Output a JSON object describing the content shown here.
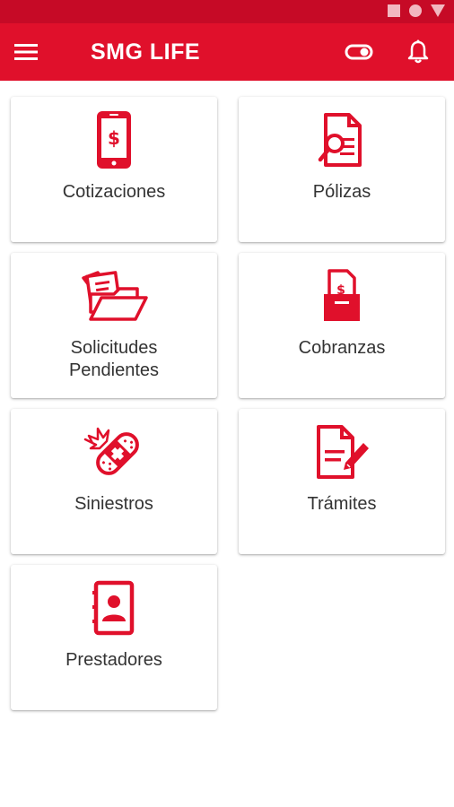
{
  "theme": {
    "primary": "#e0102b",
    "status_bar": "#c60a26",
    "text": "#333333"
  },
  "app_bar": {
    "title": "SMG LIFE",
    "icons": [
      "menu-icon",
      "toggle-icon",
      "bell-icon"
    ]
  },
  "status_bar": {
    "icons": [
      "square-icon",
      "circle-icon",
      "triangle-icon"
    ]
  },
  "menu": [
    {
      "label": "Cotizaciones",
      "icon": "phone-dollar-icon"
    },
    {
      "label": "Pólizas",
      "icon": "policy-search-icon"
    },
    {
      "label": "Solicitudes\nPendientes",
      "icon": "folder-documents-icon"
    },
    {
      "label": "Cobranzas",
      "icon": "payment-box-icon"
    },
    {
      "label": "Siniestros",
      "icon": "bandage-icon"
    },
    {
      "label": "Trámites",
      "icon": "document-edit-icon"
    },
    {
      "label": "Prestadores",
      "icon": "contact-book-icon"
    }
  ]
}
